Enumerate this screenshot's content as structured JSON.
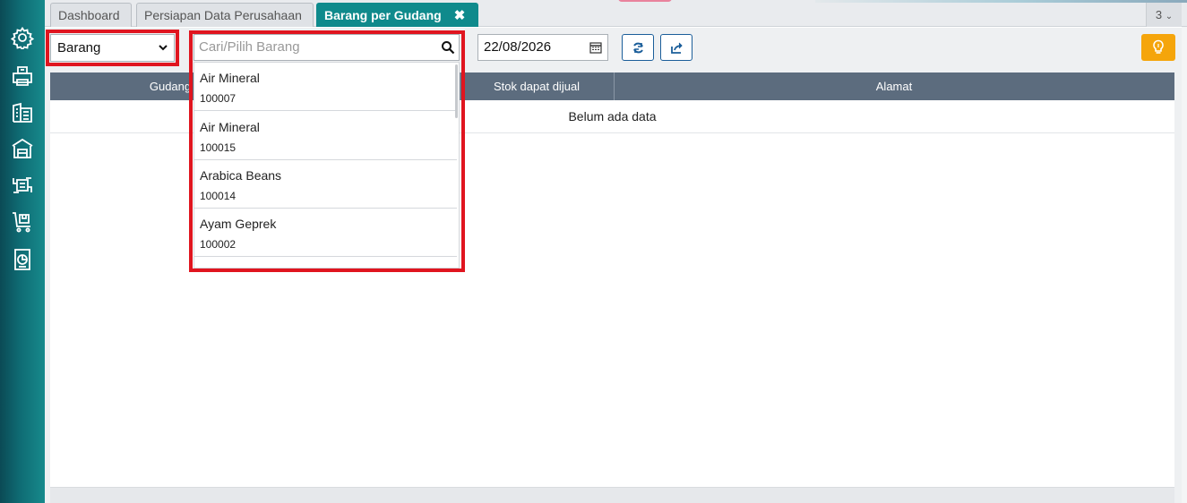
{
  "sidebar": {
    "icons": [
      "gear-icon",
      "printer-icon",
      "building-list-icon",
      "warehouse-icon",
      "box-cycle-icon",
      "cart-box-icon",
      "report-chart-icon"
    ]
  },
  "tabs": [
    {
      "label": "Dashboard",
      "active": false
    },
    {
      "label": "Persiapan Data Perusahaan",
      "active": false
    },
    {
      "label": "Barang per Gudang",
      "active": true
    }
  ],
  "tab_count": "3",
  "toolbar": {
    "filter_select": {
      "value": "Barang"
    },
    "search": {
      "placeholder": "Cari/Pilih Barang"
    },
    "date": {
      "value": "22/08/2026"
    }
  },
  "table": {
    "headers": [
      "Gudang",
      "Stok dapat dijual",
      "Alamat"
    ],
    "empty_text": "Belum ada data"
  },
  "dropdown": {
    "items": [
      {
        "name": "Air Mineral",
        "code": "100007"
      },
      {
        "name": "Air Mineral",
        "code": "100015"
      },
      {
        "name": "Arabica Beans",
        "code": "100014"
      },
      {
        "name": "Ayam Geprek",
        "code": "100002"
      }
    ]
  },
  "colors": {
    "accent": "#0f8a8c",
    "highlight": "#e0151f",
    "button_yellow": "#f5a50b",
    "table_header": "#5c6c7e"
  }
}
